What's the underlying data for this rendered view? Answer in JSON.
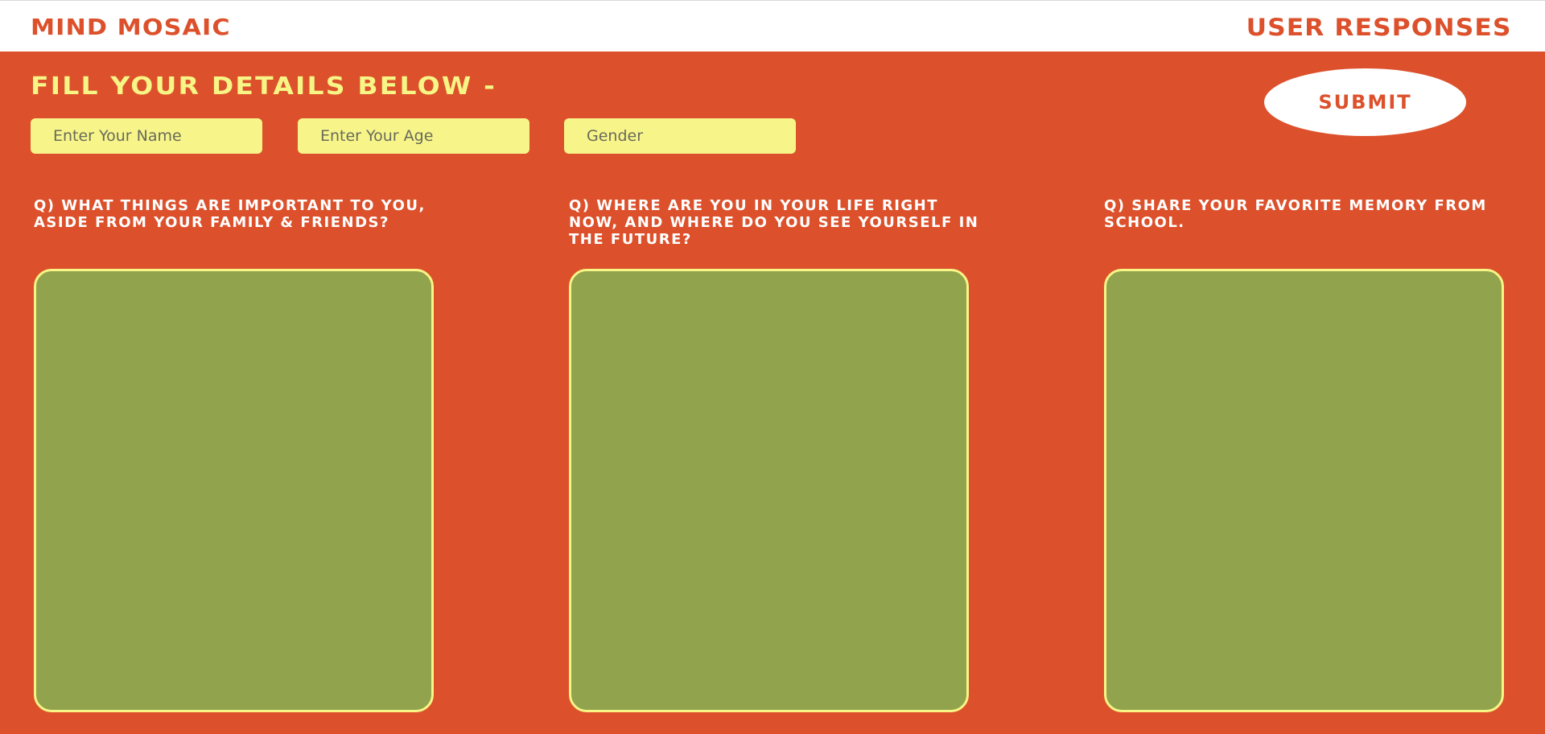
{
  "header": {
    "brand": "MIND MOSAIC",
    "responses_link": "USER RESPONSES"
  },
  "form": {
    "heading": "FILL YOUR DETAILS BELOW -",
    "submit_label": "SUBMIT",
    "name_placeholder": "Enter Your Name",
    "age_placeholder": "Enter Your Age",
    "gender_placeholder": "Gender"
  },
  "questions": [
    {
      "label": "Q) WHAT THINGS ARE IMPORTANT TO YOU, ASIDE FROM YOUR FAMILY & FRIENDS?",
      "answer": ""
    },
    {
      "label": "Q) WHERE ARE YOU IN YOUR LIFE RIGHT NOW, AND WHERE DO YOU SEE YOURSELF IN THE FUTURE?",
      "answer": ""
    },
    {
      "label": "Q) SHARE YOUR FAVORITE MEMORY FROM SCHOOL.",
      "answer": ""
    }
  ],
  "colors": {
    "background": "#dc512c",
    "header_background": "#ffffff",
    "accent_yellow": "#f7f585",
    "answer_box": "#92a34e",
    "question_text": "#ffffff"
  }
}
